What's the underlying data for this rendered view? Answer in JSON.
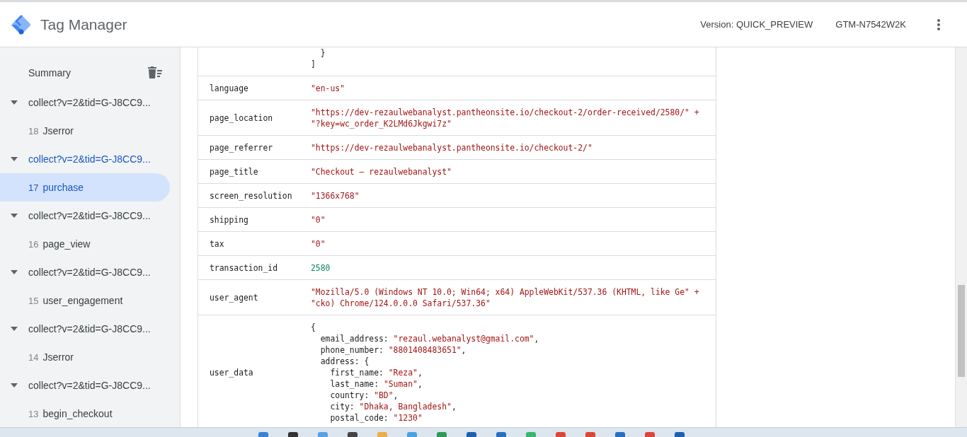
{
  "header": {
    "title": "Tag Manager",
    "version": "Version: QUICK_PREVIEW",
    "container_id": "GTM-N7542W2K"
  },
  "sidebar": {
    "summary": "Summary",
    "groups": [
      {
        "label": "collect?v=2&tid=G-J8CC9...",
        "expanded": true,
        "selected": false,
        "children": [
          {
            "number": "18",
            "label": "Jserror",
            "selected": false
          }
        ]
      },
      {
        "label": "collect?v=2&tid=G-J8CC9...",
        "expanded": true,
        "selected": true,
        "children": [
          {
            "number": "17",
            "label": "purchase",
            "selected": true
          }
        ]
      },
      {
        "label": "collect?v=2&tid=G-J8CC9...",
        "expanded": true,
        "selected": false,
        "children": [
          {
            "number": "16",
            "label": "page_view",
            "selected": false
          }
        ]
      },
      {
        "label": "collect?v=2&tid=G-J8CC9...",
        "expanded": true,
        "selected": false,
        "children": [
          {
            "number": "15",
            "label": "user_engagement",
            "selected": false
          }
        ]
      },
      {
        "label": "collect?v=2&tid=G-J8CC9...",
        "expanded": true,
        "selected": false,
        "children": [
          {
            "number": "14",
            "label": "Jserror",
            "selected": false
          }
        ]
      },
      {
        "label": "collect?v=2&tid=G-J8CC9...",
        "expanded": true,
        "selected": false,
        "children": [
          {
            "number": "13",
            "label": "begin_checkout",
            "selected": false
          }
        ]
      }
    ]
  },
  "table": {
    "rows": [
      {
        "key": "",
        "kind": "code",
        "lines": [
          "  }",
          "]"
        ]
      },
      {
        "key": "language",
        "kind": "string",
        "lines": [
          "\"en-us\""
        ]
      },
      {
        "key": "page_location",
        "kind": "string",
        "lines": [
          "\"https://dev-rezaulwebanalyst.pantheonsite.io/checkout-2/order-received/2580/\" +",
          "\"?key=wc_order_K2LMd6Jkgwi7z\""
        ]
      },
      {
        "key": "page_referrer",
        "kind": "string",
        "lines": [
          "\"https://dev-rezaulwebanalyst.pantheonsite.io/checkout-2/\""
        ]
      },
      {
        "key": "page_title",
        "kind": "string",
        "lines": [
          "\"Checkout – rezaulwebanalyst\""
        ]
      },
      {
        "key": "screen_resolution",
        "kind": "string",
        "lines": [
          "\"1366x768\""
        ]
      },
      {
        "key": "shipping",
        "kind": "string",
        "lines": [
          "\"0\""
        ]
      },
      {
        "key": "tax",
        "kind": "string",
        "lines": [
          "\"0\""
        ]
      },
      {
        "key": "transaction_id",
        "kind": "number",
        "lines": [
          "2580"
        ]
      },
      {
        "key": "user_agent",
        "kind": "string",
        "lines": [
          "\"Mozilla/5.0 (Windows NT 10.0; Win64; x64) AppleWebKit/537.36 (KHTML, like Ge\" +",
          "\"cko) Chrome/124.0.0.0 Safari/537.36\""
        ]
      },
      {
        "key": "user_data",
        "kind": "code",
        "lines": [
          "{",
          "  email_address: \"rezaul.webanalyst@gmail.com\",",
          "  phone_number: \"8801408483651\",",
          "  address: {",
          "    first_name: \"Reza\",",
          "    last_name: \"Suman\",",
          "    country: \"BD\",",
          "    city: \"Dhaka, Bangladesh\",",
          "    postal_code: \"1230\""
        ]
      }
    ]
  }
}
